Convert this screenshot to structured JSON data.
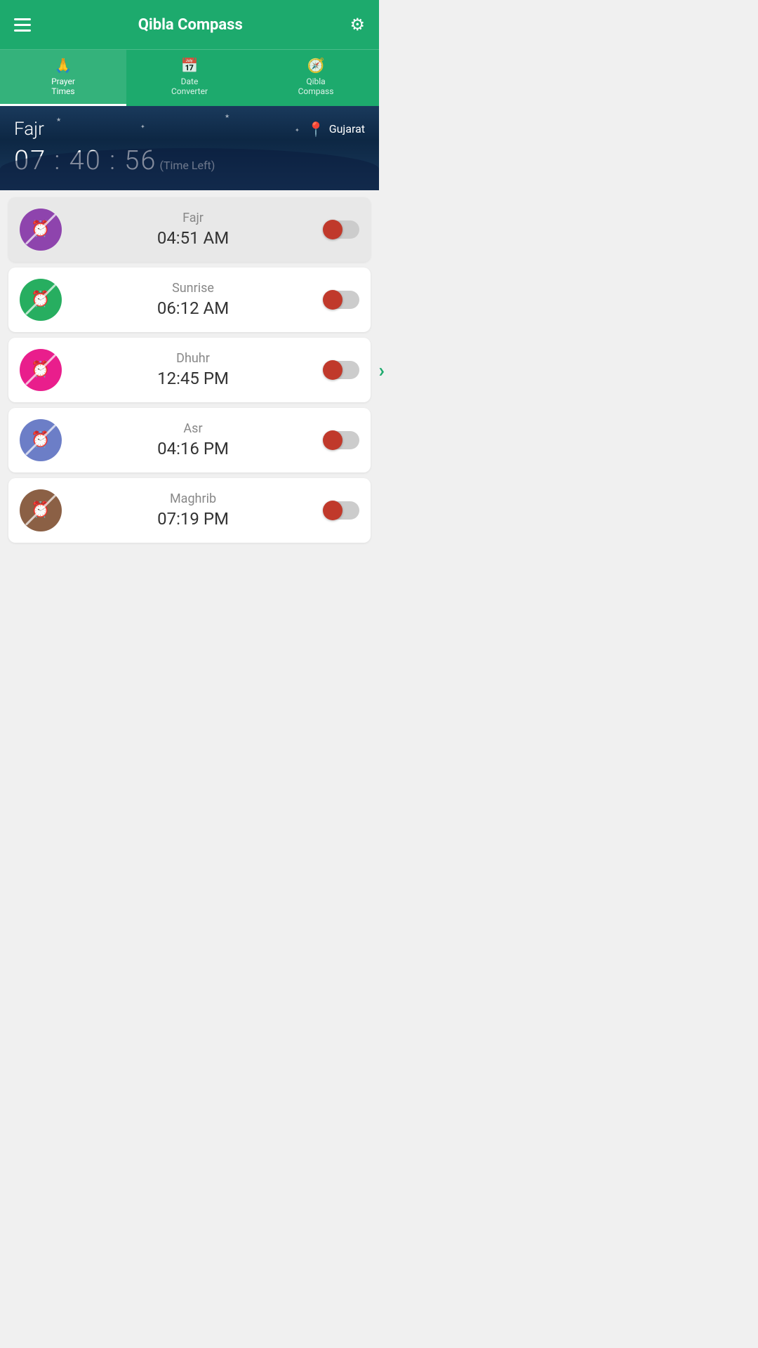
{
  "header": {
    "title": "Qibla Compass",
    "settings_label": "settings"
  },
  "tabs": [
    {
      "id": "prayer-times",
      "label": "Prayer\nTimes",
      "icon": "🙏",
      "active": true
    },
    {
      "id": "date-converter",
      "label": "Date\nConverter",
      "icon": "📅",
      "active": false
    },
    {
      "id": "qibla-compass",
      "label": "Qibla\nCompass",
      "icon": "🧭",
      "active": false
    }
  ],
  "banner": {
    "prayer_name": "Fajr",
    "location": "Gujarat",
    "timer": "07 : 40 : 56",
    "time_left_label": "(Time Left)"
  },
  "prayers": [
    {
      "name": "Fajr",
      "time": "04:51 AM",
      "color_class": "purple",
      "muted": true,
      "toggle_on": false
    },
    {
      "name": "Sunrise",
      "time": "06:12 AM",
      "color_class": "green",
      "muted": false,
      "toggle_on": false
    },
    {
      "name": "Dhuhr",
      "time": "12:45 PM",
      "color_class": "pink",
      "muted": false,
      "toggle_on": false
    },
    {
      "name": "Asr",
      "time": "04:16 PM",
      "color_class": "blue-purple",
      "muted": false,
      "toggle_on": false
    },
    {
      "name": "Maghrib",
      "time": "07:19 PM",
      "color_class": "brown",
      "muted": false,
      "toggle_on": false
    }
  ],
  "nav": {
    "prev": "‹",
    "next": "›"
  }
}
